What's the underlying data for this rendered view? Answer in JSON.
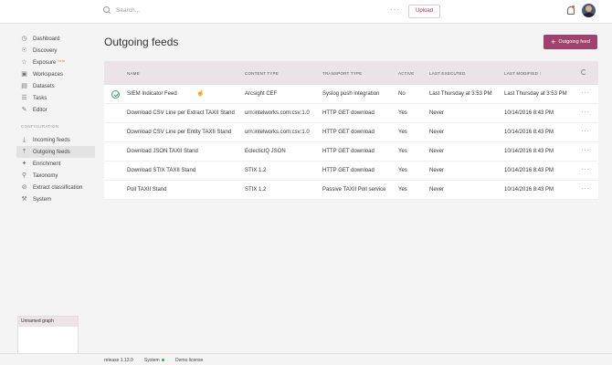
{
  "header": {
    "search_placeholder": "Search...",
    "more_label": "···",
    "upload_label": "Upload"
  },
  "sidebar": {
    "items": [
      {
        "label": "Dashboard",
        "icon": "dashboard-icon"
      },
      {
        "label": "Discovery",
        "icon": "compass-icon"
      },
      {
        "label": "Exposure",
        "icon": "star-icon",
        "badge": "beta"
      },
      {
        "label": "Workspaces",
        "icon": "briefcase-icon"
      },
      {
        "label": "Datasets",
        "icon": "folder-icon"
      },
      {
        "label": "Tasks",
        "icon": "checklist-icon"
      },
      {
        "label": "Editor",
        "icon": "pencil-icon"
      }
    ],
    "section_label": "CONFIGURATION",
    "config_items": [
      {
        "label": "Incoming feeds",
        "icon": "download-icon"
      },
      {
        "label": "Outgoing feeds",
        "icon": "upload-icon",
        "active": true
      },
      {
        "label": "Enrichment",
        "icon": "enrichment-icon"
      },
      {
        "label": "Taxonomy",
        "icon": "taxonomy-icon"
      },
      {
        "label": "Extract classification",
        "icon": "block-icon"
      },
      {
        "label": "System",
        "icon": "wrench-icon"
      }
    ]
  },
  "graph_panel": {
    "title": "Unnamed graph"
  },
  "main": {
    "title": "Outgoing feeds",
    "add_button_label": "Outgoing feed",
    "table": {
      "columns": [
        "NAME",
        "CONTENT TYPE",
        "TRANSPORT TYPE",
        "ACTIVE",
        "LAST EXECUTED",
        "LAST MODIFIED ↑"
      ],
      "rows": [
        [
          "SIEM Indicator Feed",
          "Arcsight CEF",
          "Syslog push integration",
          "No",
          "Last Thursday at 3:53 PM",
          "Last Thursday at 3:53 PM"
        ],
        [
          "Download CSV Line per Extract TAXII Stand",
          "urn:intelworks.com:csv:1.0",
          "HTTP GET download",
          "Yes",
          "Never",
          "10/14/2016 8:43 PM"
        ],
        [
          "Download CSV Line per Entity TAXII Stand",
          "urn:intelworks.com:csv:1.0",
          "HTTP GET download",
          "Yes",
          "Never",
          "10/14/2016 8:43 PM"
        ],
        [
          "Download JSON TAXII Stand",
          "EclecticIQ JSON",
          "HTTP GET download",
          "Yes",
          "Never",
          "10/14/2016 8:43 PM"
        ],
        [
          "Download STIX TAXII Stand",
          "STIX 1.2",
          "HTTP GET download",
          "Yes",
          "Never",
          "10/14/2016 8:43 PM"
        ],
        [
          "Poll TAXII Stand",
          "STIX 1.2",
          "Passive TAXII Poll service",
          "Yes",
          "Never",
          "10/14/2016 8:43 PM"
        ]
      ]
    }
  },
  "footer": {
    "release": "release 1.13.0",
    "system": "System",
    "license": "Demo license"
  }
}
